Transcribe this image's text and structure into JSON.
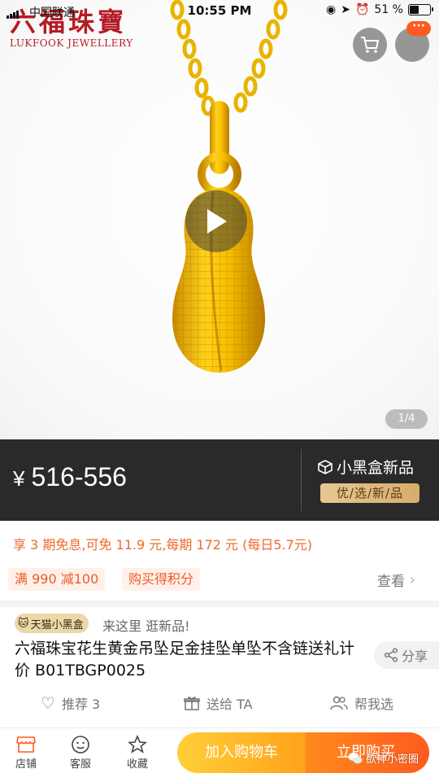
{
  "status_bar": {
    "carrier": "中国联通",
    "time": "10:55 PM",
    "battery": "51 %",
    "battery_level": 0.51
  },
  "brand": {
    "name_cn": "六福珠寶",
    "name_en": "LUKFOOK JEWELLERY",
    "color": "#b51c25"
  },
  "media": {
    "page_indicator": "1/4",
    "play_icon": "play-icon",
    "more_badge": "···"
  },
  "price": {
    "currency": "¥",
    "range": "516-556",
    "new_tag": "小黑盒新品",
    "new_tag_sub": "优/选/新/品"
  },
  "promo": {
    "installment": "享 3 期免息,可免 11.9 元,每期 172 元 (每日5.7元)",
    "chips": [
      "满 990 减100",
      "购买得积分"
    ],
    "more_label": "查看"
  },
  "title": {
    "tmall_chip": "天猫小黑盒",
    "slogan": "来这里 逛新品!",
    "text": "六福珠宝花生黄金吊坠足金挂坠单坠不含链送礼计价 B01TBGP0025",
    "share_label": "分享"
  },
  "social": {
    "recommend": "推荐 3",
    "gift": "送给 TA",
    "help": "帮我选"
  },
  "bottom_bar": {
    "shop": "店铺",
    "service": "客服",
    "favorite": "收藏",
    "add_cart": "加入购物车",
    "buy_now": "立即购买",
    "watermark": "欲神小密圈"
  },
  "colors": {
    "accent_orange": "#ff5a1f",
    "cart_yellow": "#ffb12a",
    "price_band": "#2a2a2a",
    "gold": "#e7c892"
  }
}
